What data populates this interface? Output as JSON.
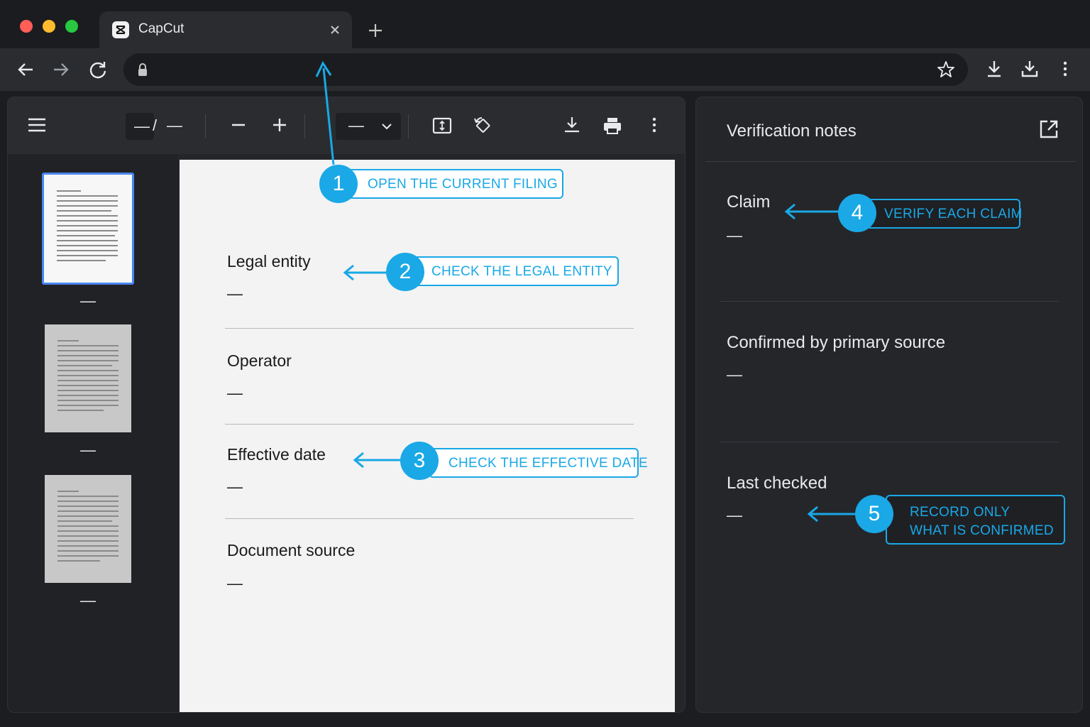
{
  "browser": {
    "tab_title": "CapCut",
    "address": ""
  },
  "viewer": {
    "page_current": "—",
    "page_separator": "/",
    "page_total": "—",
    "zoom_value": "—",
    "thumbnails": [
      {
        "label": "—"
      },
      {
        "label": "—"
      },
      {
        "label": "—"
      }
    ]
  },
  "document": {
    "fields": [
      {
        "label": "Legal entity",
        "value": "—"
      },
      {
        "label": "Operator",
        "value": "—"
      },
      {
        "label": "Effective date",
        "value": "—"
      },
      {
        "label": "Document source",
        "value": "—"
      }
    ]
  },
  "notes": {
    "title": "Verification notes",
    "items": [
      {
        "label": "Claim",
        "value": "—"
      },
      {
        "label": "Confirmed by primary source",
        "value": "—"
      },
      {
        "label": "Last checked",
        "value": "—"
      }
    ]
  },
  "callouts": [
    {
      "number": "1",
      "text": "OPEN THE CURRENT FILING"
    },
    {
      "number": "2",
      "text": "CHECK THE LEGAL ENTITY"
    },
    {
      "number": "3",
      "text": "CHECK THE EFFECTIVE DATE"
    },
    {
      "number": "4",
      "text": "VERIFY EACH CLAIM"
    },
    {
      "number": "5",
      "text_line1": "RECORD ONLY",
      "text_line2": "WHAT IS CONFIRMED"
    }
  ],
  "colors": {
    "accent": "#1aa8e6",
    "chrome_bg": "#1b1c1f",
    "panel_bg": "#25262a",
    "page_bg": "#f3f3f3"
  }
}
